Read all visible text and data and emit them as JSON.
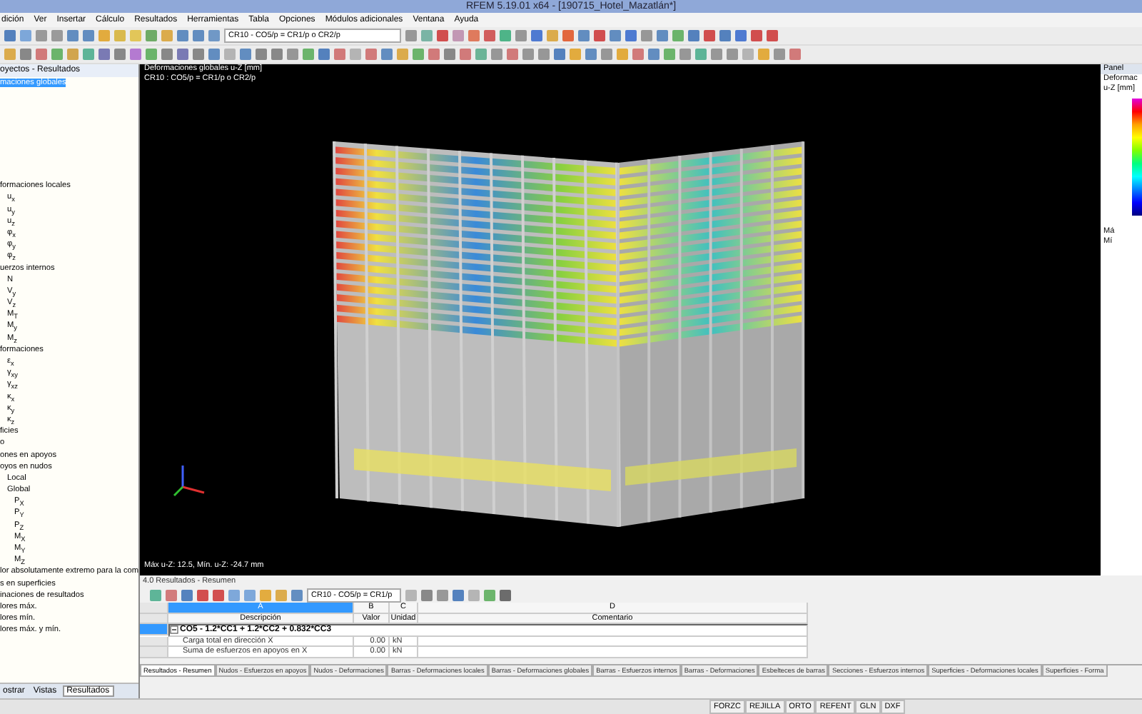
{
  "window": {
    "title": "RFEM 5.19.01 x64 - [190715_Hotel_Mazatlán*]"
  },
  "menu": [
    "dición",
    "Ver",
    "Insertar",
    "Cálculo",
    "Resultados",
    "Herramientas",
    "Tabla",
    "Opciones",
    "Módulos adicionales",
    "Ventana",
    "Ayuda"
  ],
  "toolbar": {
    "combo": "CR10 - CO5/p = CR1/p o CR2/p"
  },
  "navigator": {
    "title": "oyectos - Resultados",
    "tree": [
      {
        "label": "maciones globales",
        "selected": true
      },
      {
        "label": "formaciones locales",
        "selected": false,
        "children": [
          {
            "label": "u$_{x}$",
            "selected": false
          },
          {
            "label": "u$_{y}$",
            "selected": false
          },
          {
            "label": "u$_{z}$",
            "selected": false
          },
          {
            "label": "φ$_{x}$",
            "selected": false
          },
          {
            "label": "φ$_{y}$",
            "selected": false
          },
          {
            "label": "φ$_{z}$",
            "selected": false
          }
        ]
      },
      {
        "label": "uerzos internos",
        "selected": false,
        "children": [
          {
            "label": "N",
            "selected": false
          },
          {
            "label": "V$_{y}$",
            "selected": false
          },
          {
            "label": "V$_{z}$",
            "selected": false
          },
          {
            "label": "M$_{T}$",
            "selected": false
          },
          {
            "label": "M$_{y}$",
            "selected": false
          },
          {
            "label": "M$_{z}$",
            "selected": false
          }
        ]
      },
      {
        "label": "formaciones",
        "selected": false,
        "children": [
          {
            "label": "ε$_{x}$",
            "selected": false
          },
          {
            "label": "γ$_{xy}$",
            "selected": false
          },
          {
            "label": "γ$_{xz}$",
            "selected": false
          },
          {
            "label": "κ$_{x}$",
            "selected": false
          },
          {
            "label": "κ$_{y}$",
            "selected": false
          },
          {
            "label": "κ$_{z}$",
            "selected": false
          }
        ]
      },
      {
        "label": "ficies",
        "selected": false
      },
      {
        "label": "o",
        "selected": false
      },
      {
        "label": "ones en apoyos",
        "selected": false
      },
      {
        "label": "oyos en nudos",
        "selected": false,
        "children": [
          {
            "label": "Local",
            "selected": false
          },
          {
            "label": "Global",
            "selected": false,
            "children": [
              {
                "label": "P$_{X}$",
                "selected": false
              },
              {
                "label": "P$_{Y}$",
                "selected": false
              },
              {
                "label": "P$_{Z}$",
                "selected": false
              },
              {
                "label": "M$_{X}$",
                "selected": false
              },
              {
                "label": "M$_{Y}$",
                "selected": false
              },
              {
                "label": "M$_{Z}$",
                "selected": false
              }
            ]
          }
        ]
      },
      {
        "label": "lor absolutamente extremo para la com",
        "selected": false
      },
      {
        "label": "s en superficies",
        "selected": false
      },
      {
        "label": "inaciones de resultados",
        "selected": false
      },
      {
        "label": "lores máx.",
        "selected": false
      },
      {
        "label": "lores mín.",
        "selected": false
      },
      {
        "label": "lores máx. y mín.",
        "selected": false
      }
    ],
    "tabs": [
      {
        "label": "ostrar",
        "selected": false
      },
      {
        "label": "Vistas",
        "selected": false
      },
      {
        "label": "Resultados",
        "selected": true
      }
    ]
  },
  "viewport": {
    "title": "Deformaciones globales u-Z [mm]",
    "subtitle": "CR10 : CO5/p = CR1/p o CR2/p",
    "summary": "Máx u-Z: 12.5, Mín. u-Z: -24.7 mm"
  },
  "panel": {
    "title": "Panel",
    "heading": "Deformac",
    "unit": "u-Z [mm]",
    "max_label": "Má",
    "min_label": "Mí"
  },
  "results": {
    "title": "4.0 Resultados - Resumen",
    "combo": "CR10 - CO5/p = CR1/p",
    "columns": [
      {
        "letter": "A",
        "heading": "Descripción",
        "selected": true
      },
      {
        "letter": "B",
        "heading": "Valor",
        "selected": false
      },
      {
        "letter": "C",
        "heading": "Unidad",
        "selected": false
      },
      {
        "letter": "D",
        "heading": "Comentario",
        "selected": false
      }
    ],
    "group": {
      "label": "CO5 - 1.2*CC1 + 1.2*CC2 + 0.832*CC3",
      "expanded": true,
      "rows": [
        {
          "description": "Carga total en dirección X",
          "value": "0.00",
          "unit": "kN"
        },
        {
          "description": "Suma de esfuerzos en apoyos en X",
          "value": "0.00",
          "unit": "kN"
        }
      ]
    },
    "tabs": [
      {
        "label": "Resultados - Resumen",
        "selected": true
      },
      {
        "label": "Nudos - Esfuerzos en apoyos",
        "selected": false
      },
      {
        "label": "Nudos - Deformaciones",
        "selected": false
      },
      {
        "label": "Barras - Deformaciones locales",
        "selected": false
      },
      {
        "label": "Barras - Deformaciones globales",
        "selected": false
      },
      {
        "label": "Barras - Esfuerzos internos",
        "selected": false
      },
      {
        "label": "Barras - Deformaciones",
        "selected": false
      },
      {
        "label": "Esbelteces de barras",
        "selected": false
      },
      {
        "label": "Secciones - Esfuerzos internos",
        "selected": false
      },
      {
        "label": "Superficies - Deformaciones locales",
        "selected": false
      },
      {
        "label": "Superficies - Forma",
        "selected": false
      }
    ]
  },
  "status_bar": [
    "FORZC",
    "REJILLA",
    "ORTO",
    "REFENT",
    "GLN",
    "DXF"
  ]
}
